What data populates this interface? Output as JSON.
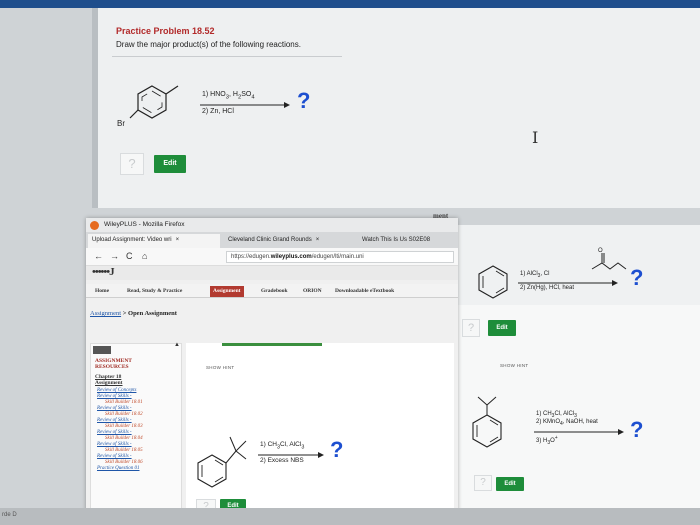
{
  "back_window": {
    "title": "Practice Problem 18.52",
    "instruction": "Draw the major product(s) of the following reactions.",
    "reaction1": {
      "substituent": "Br",
      "reagent1": "1) HNO",
      "reagent1_b": "3",
      "reagent1_c": ", H",
      "reagent1_d": "2",
      "reagent1_e": "SO",
      "reagent1_f": "4",
      "reagent2": "2) Zn, HCl",
      "question": "?"
    },
    "hint_glyph": "?",
    "edit_label": "Edit",
    "cursor": "I",
    "partial_text": "ment"
  },
  "middle_window": {
    "window_title": "WileyPLUS - Mozilla Firefox",
    "tabs": [
      {
        "label": "Upload Assignment: Video wri",
        "close": "×"
      },
      {
        "label": "Cleveland Clinic Grand Rounds",
        "close": "×"
      },
      {
        "label": "Watch This Is Us S02E08"
      }
    ],
    "nav": {
      "back": "←",
      "forward": "→",
      "reload": "C",
      "home": "⌂"
    },
    "url_prefix": "https://edugen.",
    "url_domain": "wileyplus.com",
    "url_suffix": "/edugen/lti/main.uni",
    "logo_text": "••••••J",
    "nav_tabs": [
      "Home",
      "Read, Study & Practice",
      "Assignment",
      "Gradebook",
      "ORION",
      "Downloadable eTextbook"
    ],
    "breadcrumb_link": "Assignment",
    "breadcrumb_current": "> Open Assignment",
    "sidebar": {
      "title_line1": "ASSIGNMENT",
      "title_line2": "RESOURCES",
      "chapter_line1": "Chapter 18",
      "chapter_line2": "Assignment",
      "items": [
        {
          "text": "Review of Concepts",
          "type": "link"
        },
        {
          "text": "Review of Skills -",
          "type": "link"
        },
        {
          "text": "Skill Builder 18.01",
          "type": "sub"
        },
        {
          "text": "Review of Skills -",
          "type": "link"
        },
        {
          "text": "Skill Builder 18.02",
          "type": "sub"
        },
        {
          "text": "Review of Skills -",
          "type": "link"
        },
        {
          "text": "Skill Builder 18.03",
          "type": "sub"
        },
        {
          "text": "Review of Skills -",
          "type": "link"
        },
        {
          "text": "Skill Builder 18.04",
          "type": "sub"
        },
        {
          "text": "Review of Skills -",
          "type": "link"
        },
        {
          "text": "Skill Builder 18.05",
          "type": "sub"
        },
        {
          "text": "Review of Skills -",
          "type": "link"
        },
        {
          "text": "Skill Builder 18.06",
          "type": "sub"
        },
        {
          "text": "Practice Question 01",
          "type": "link"
        }
      ],
      "scroll_glyph": "▲"
    },
    "show_hint_label": "SHOW HINT",
    "reaction": {
      "reagent1": "1) CH",
      "reagent1_b": "3",
      "reagent1_c": "Cl, AlCl",
      "reagent1_d": "3",
      "reagent2": "2) Excess NBS",
      "question": "?"
    },
    "hint_glyph": "?",
    "edit_label": "Edit"
  },
  "right_window": {
    "reaction_top": {
      "r1": "1) AlCl",
      "r1_b": "3",
      "r1_c": ", Cl",
      "r2": "2) Zn(Hg), HCl, heat",
      "question": "?",
      "carbonyl_o": "O"
    },
    "show_hint_label": "SHOW HINT",
    "hint_glyph": "?",
    "edit_label": "Edit",
    "reaction_bottom": {
      "r1": "1) CH",
      "r1_b": "3",
      "r1_c": "Cl, AlCl",
      "r1_d": "3",
      "r2": "2) KMnO",
      "r2_b": "4",
      "r2_c": ", NaOH, heat",
      "r3": "3) H",
      "r3_b": "3",
      "r3_c": "O",
      "r3_d": "+",
      "question": "?"
    }
  },
  "bottom": {
    "left_text": "rde  D"
  },
  "colors": {
    "accent_red": "#b22a2a",
    "edit_green": "#1e8d3a",
    "question_blue": "#1d4fd0",
    "tab_active_red": "#b23a30"
  }
}
